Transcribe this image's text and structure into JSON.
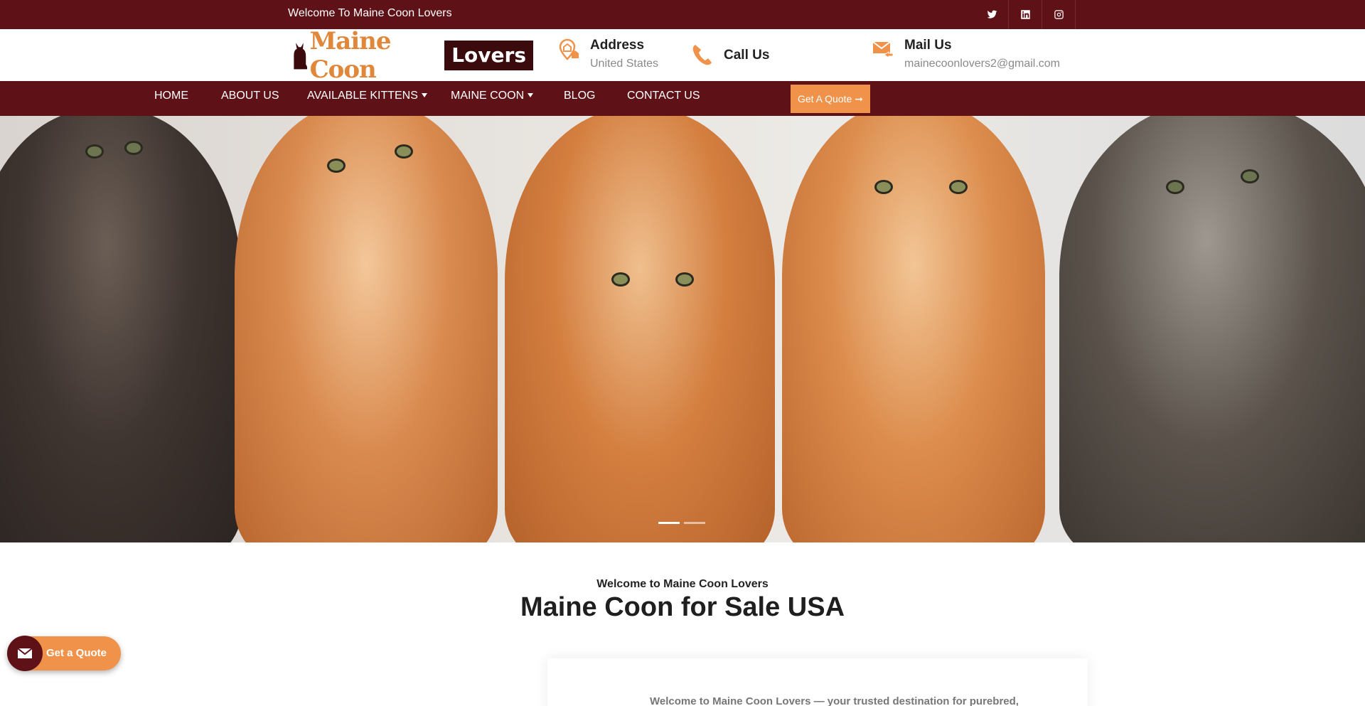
{
  "topbar": {
    "welcome": "Welcome To Maine Coon Lovers",
    "social_icons": [
      "twitter-icon",
      "linkedin-icon",
      "instagram-icon"
    ]
  },
  "header": {
    "logo": {
      "part1": "Maine Coon",
      "part2": "Lovers"
    },
    "address": {
      "title": "Address",
      "value": "United States",
      "icon": "location-home-icon"
    },
    "call": {
      "title": "Call Us",
      "icon": "phone-icon"
    },
    "mail": {
      "title": "Mail Us",
      "value": "mainecoonlovers2@gmail.com",
      "icon": "envelope-icon"
    }
  },
  "nav": {
    "items": [
      {
        "label": "HOME"
      },
      {
        "label": "ABOUT US"
      },
      {
        "label": "AVAILABLE KITTENS"
      },
      {
        "label": "MAINE COON"
      },
      {
        "label": "BLOG"
      },
      {
        "label": "CONTACT US"
      }
    ],
    "quote_button": "Get A Quote",
    "quote_arrow": "➞"
  },
  "hero": {
    "slides": 2,
    "active_slide": 1
  },
  "intro": {
    "kicker": "Welcome to Maine Coon Lovers",
    "title": "Maine Coon for Sale USA",
    "text": "Welcome to Maine Coon Lovers — your trusted destination for purebred,"
  },
  "floating": {
    "label": "Get a Quote"
  },
  "colors": {
    "maroon": "#5e1117",
    "orange": "#f0924a",
    "logo_orange": "#e0873a"
  }
}
